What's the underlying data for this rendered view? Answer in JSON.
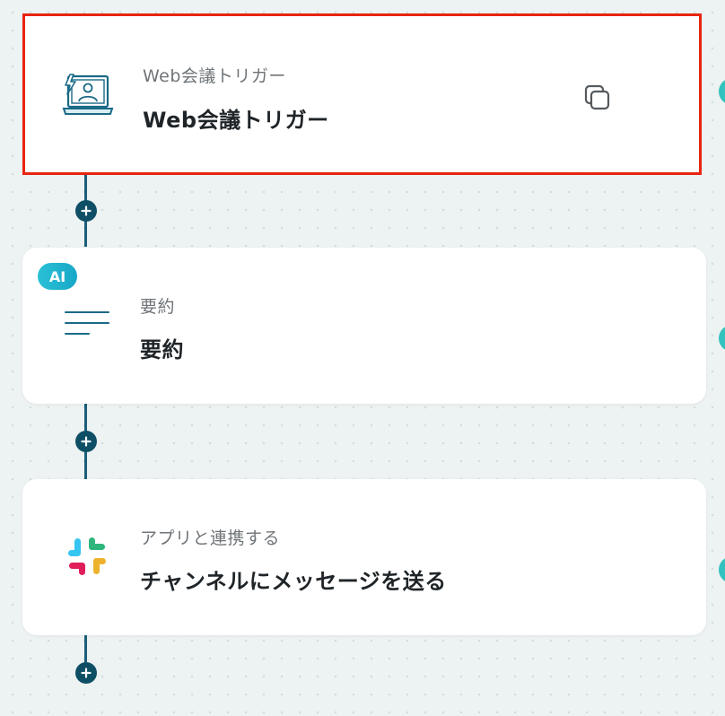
{
  "flow": {
    "steps": [
      {
        "subtitle": "Web会議トリガー",
        "title": "Web会議トリガー",
        "icon": "web-meeting-icon",
        "selected": true,
        "action": "copy-icon"
      },
      {
        "subtitle": "要約",
        "title": "要約",
        "icon": "summary-lines-icon",
        "badge": "AI"
      },
      {
        "subtitle": "アプリと連携する",
        "title": "チャンネルにメッセージを送る",
        "icon": "slack-icon"
      }
    ],
    "add_step_icon": "plus-icon"
  },
  "colors": {
    "selected_border": "#e8250e",
    "connector": "#1a5f78",
    "add_button": "#0f4f66",
    "ai_badge": "#29c1d6",
    "edge_marker": "#33c2bd",
    "slack": [
      "#36c5f0",
      "#2eb67d",
      "#ecb22e",
      "#e01e5a"
    ]
  }
}
